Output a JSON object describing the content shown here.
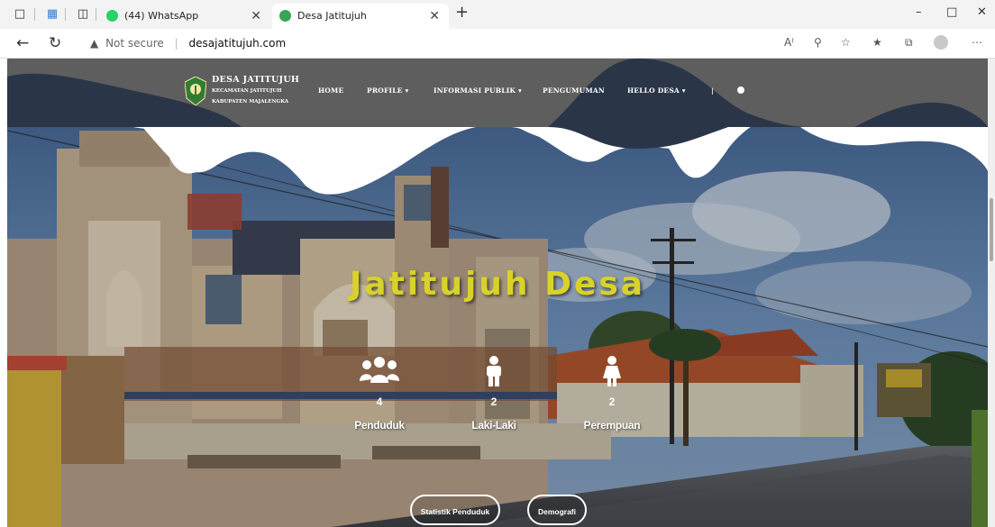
{
  "browser": {
    "tabs": [
      {
        "label": "(44) WhatsApp",
        "favicon_color": "#25d366"
      },
      {
        "label": "Desa Jatitujuh",
        "favicon_color": "#3aa357"
      }
    ],
    "new_tab_label": "+",
    "url": {
      "security_text": "Not secure",
      "address": "desajatitujuh.com"
    }
  },
  "site": {
    "brand": {
      "title": "DESA JATITUJUH",
      "subtitle1": "KECAMATAN JATITUJUH",
      "subtitle2": "KABUPATEN MAJALENGKA"
    },
    "nav": {
      "home": "HOME",
      "profile": "PROFILE",
      "informasi": "INFORMASI PUBLIK",
      "pengumuman": "PENGUMUMAN",
      "hello": "HELLO DESA",
      "sep": "|"
    },
    "hero_title": "Jatitujuh Desa",
    "stats": [
      {
        "value": "4",
        "label": "Penduduk",
        "icon": "users-icon"
      },
      {
        "value": "2",
        "label": "Laki-Laki",
        "icon": "male-icon"
      },
      {
        "value": "2",
        "label": "Perempuan",
        "icon": "female-icon"
      }
    ],
    "buttons": {
      "statistik": "Statistik Penduduk",
      "demografi": "Demografi"
    },
    "colors": {
      "header_band": "#5e5e5e",
      "wave_navy": "#2b3548",
      "title_yellow": "#d8d22a"
    }
  }
}
